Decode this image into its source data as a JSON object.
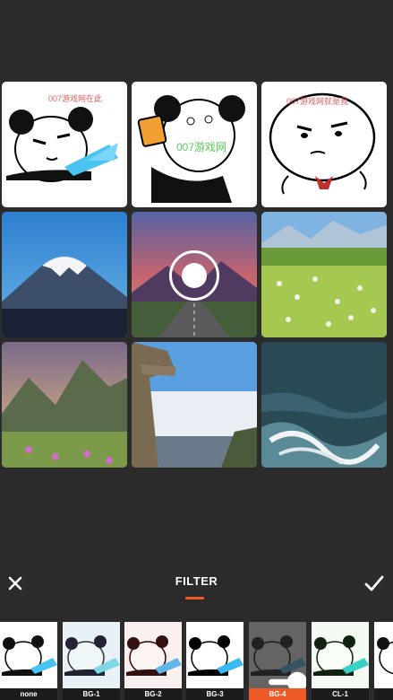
{
  "grid": {
    "meme1_text": "007游戏网在此",
    "meme2_text": "007游戏网",
    "meme3_text": "007游戏网就是我"
  },
  "toolbar": {
    "title": "FILTER",
    "close_icon": "close-icon",
    "apply_icon": "check-icon"
  },
  "filters": [
    {
      "label": "none"
    },
    {
      "label": "BG-1"
    },
    {
      "label": "BG-2"
    },
    {
      "label": "BG-3"
    },
    {
      "label": "BG-4",
      "selected": true
    },
    {
      "label": "CL-1"
    }
  ],
  "colors": {
    "accent": "#f05a28",
    "background": "#2b2b2b"
  }
}
